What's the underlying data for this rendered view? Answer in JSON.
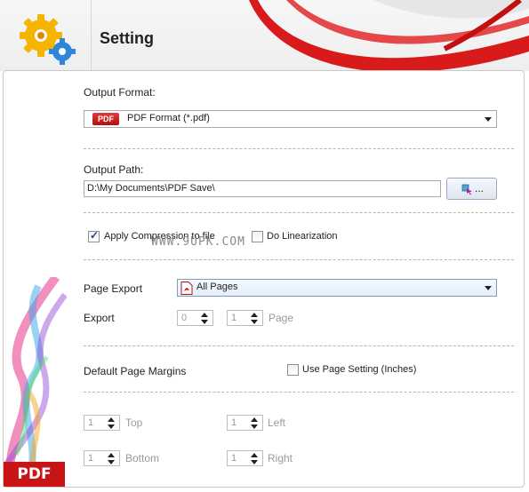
{
  "window": {
    "title": "Setting"
  },
  "output_format": {
    "label": "Output Format:",
    "chip": "PDF",
    "selected": "PDF Format (*.pdf)"
  },
  "output_path": {
    "label": "Output Path:",
    "value": "D:\\My Documents\\PDF Save\\",
    "browse_label": "..."
  },
  "options": {
    "apply_compression": {
      "label": "Apply Compression to file",
      "checked": true
    },
    "do_linearization": {
      "label": "Do Linearization",
      "checked": false
    }
  },
  "watermark": "WWW.9UPK.COM",
  "page_export": {
    "label": "Page Export",
    "selected": "All Pages",
    "export_label": "Export",
    "from": "0",
    "to": "1",
    "page_label": "Page"
  },
  "margins": {
    "label": "Default Page Margins",
    "use_page_setting": {
      "label": "Use Page Setting (Inches)",
      "checked": false
    },
    "top": {
      "label": "Top",
      "value": "1"
    },
    "left": {
      "label": "Left",
      "value": "1"
    },
    "bottom": {
      "label": "Bottom",
      "value": "1"
    },
    "right": {
      "label": "Right",
      "value": "1"
    }
  },
  "side_badge": "PDF",
  "colors": {
    "accent_red": "#c81414",
    "pdf_chip": "#c62020",
    "dash": "#b5b5b5",
    "field_border": "#a9a9a9"
  },
  "icons": {
    "header": "gears-icon",
    "browse": "folder-browse-icon",
    "page_select": "pdf-doc-icon"
  }
}
